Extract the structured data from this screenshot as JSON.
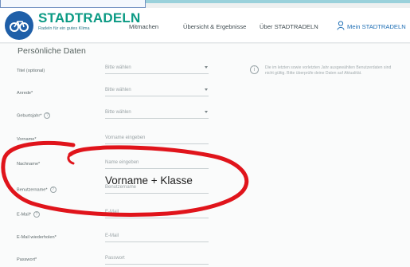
{
  "header": {
    "brand_title": "STADTRADELN",
    "brand_subtitle": "Radeln für ein gutes Klima",
    "nav": [
      {
        "label": "Mitmachen"
      },
      {
        "label": "Übersicht & Ergebnisse"
      },
      {
        "label": "Über STADTRADELN"
      },
      {
        "label": "Mein STADTRADELN"
      }
    ]
  },
  "page": {
    "title": "Persönliche Daten",
    "info_text": "Die im letzten sowie vorletzten Jahr ausgewählten Benutzerdaten sind nicht gültig. Bitte überprüfe deine Daten auf Aktualität."
  },
  "form": {
    "fields": [
      {
        "label": "Titel (optional)",
        "value": "Bitte wählen",
        "type": "select"
      },
      {
        "label": "Anrede*",
        "value": "Bitte wählen",
        "type": "select"
      },
      {
        "label": "Geburtsjahr*",
        "value": "Bitte wählen",
        "type": "select"
      },
      {
        "label": "Vorname*",
        "placeholder": "Vorname eingeben"
      },
      {
        "label": "Nachname*",
        "placeholder": "Name eingeben"
      },
      {
        "label": "Benutzername*",
        "placeholder": "Benutzername"
      },
      {
        "label": "E-Mail*",
        "placeholder": "E-Mail"
      },
      {
        "label": "E-Mail wiederholen*",
        "placeholder": "E-Mail"
      },
      {
        "label": "Passwort*",
        "placeholder": "Passwort"
      }
    ]
  },
  "annotation": {
    "handwritten_text": "Vorname + Klasse",
    "circle_color": "#e0141b"
  },
  "colors": {
    "brand": "#0b9a84",
    "logo_bg": "#1f5fa8",
    "link": "#1f6fb5"
  }
}
